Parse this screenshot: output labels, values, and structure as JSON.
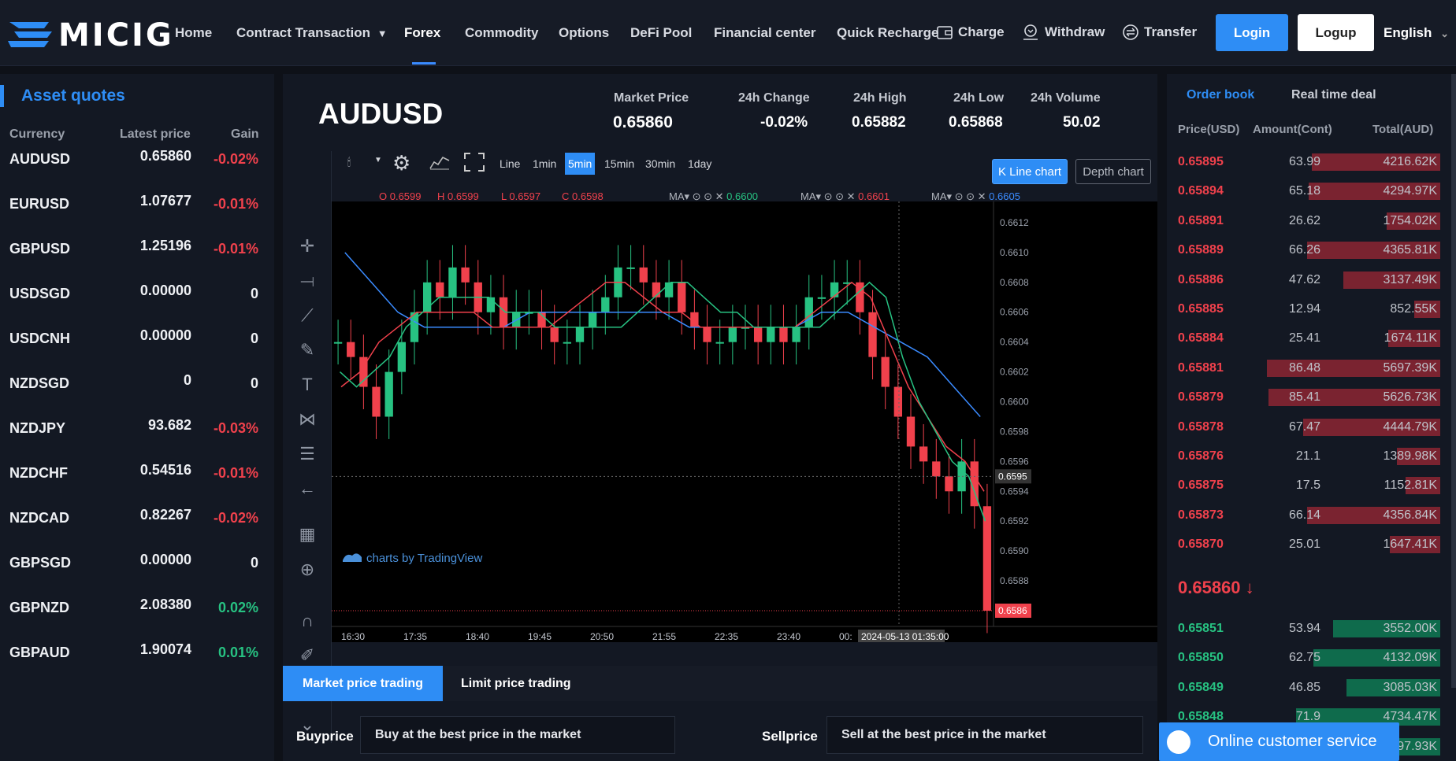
{
  "nav": {
    "logo_text": "MICIG",
    "items": [
      "Home",
      "Contract Transaction",
      "Forex",
      "Commodity",
      "Options",
      "DeFi Pool",
      "Financial center",
      "Quick Recharge"
    ],
    "actions": [
      "Charge",
      "Withdraw",
      "Transfer"
    ],
    "login_label": "Login",
    "logup_label": "Logup",
    "language": "English"
  },
  "quotes": {
    "title": "Asset quotes",
    "headers": [
      "Currency",
      "Latest price",
      "Gain"
    ],
    "rows": [
      {
        "sym": "AUDUSD",
        "price": "0.65860",
        "gain": "-0.02%",
        "dir": "neg"
      },
      {
        "sym": "EURUSD",
        "price": "1.07677",
        "gain": "-0.01%",
        "dir": "neg"
      },
      {
        "sym": "GBPUSD",
        "price": "1.25196",
        "gain": "-0.01%",
        "dir": "neg"
      },
      {
        "sym": "USDSGD",
        "price": "0.00000",
        "gain": "0",
        "dir": "zero"
      },
      {
        "sym": "USDCNH",
        "price": "0.00000",
        "gain": "0",
        "dir": "zero"
      },
      {
        "sym": "NZDSGD",
        "price": "0",
        "gain": "0",
        "dir": "zero"
      },
      {
        "sym": "NZDJPY",
        "price": "93.682",
        "gain": "-0.03%",
        "dir": "neg"
      },
      {
        "sym": "NZDCHF",
        "price": "0.54516",
        "gain": "-0.01%",
        "dir": "neg"
      },
      {
        "sym": "NZDCAD",
        "price": "0.82267",
        "gain": "-0.02%",
        "dir": "neg"
      },
      {
        "sym": "GBPSGD",
        "price": "0.00000",
        "gain": "0",
        "dir": "zero"
      },
      {
        "sym": "GBPNZD",
        "price": "2.08380",
        "gain": "0.02%",
        "dir": "pos"
      },
      {
        "sym": "GBPAUD",
        "price": "1.90074",
        "gain": "0.01%",
        "dir": "pos"
      }
    ]
  },
  "ticker": {
    "pair": "AUDUSD",
    "market_price_label": "Market Price",
    "market_price": "0.65860",
    "change_label": "24h Change",
    "change": "-0.02%",
    "high_label": "24h High",
    "high": "0.65882",
    "low_label": "24h Low",
    "low": "0.65868",
    "volume_label": "24h Volume",
    "volume": "50.02"
  },
  "chart_toolbar": {
    "intervals": [
      "Line",
      "1min",
      "5min",
      "15min",
      "30min",
      "1day"
    ],
    "selected": "5min",
    "kline_label": "K Line chart",
    "depth_label": "Depth chart",
    "ohlc": {
      "o": "O 0.6599",
      "h": "H 0.6599",
      "l": "L 0.6597",
      "c": "C 0.6598"
    },
    "ma": [
      {
        "label": "MA",
        "value": "0.6600",
        "color": "#27c282"
      },
      {
        "label": "MA",
        "value": "0.6601",
        "color": "#f0414c"
      },
      {
        "label": "MA",
        "value": "0.6605",
        "color": "#3a8bff"
      }
    ],
    "watermark": "charts by TradingView"
  },
  "chart_data": {
    "type": "candlestick",
    "pair": "AUDUSD",
    "interval": "5min",
    "x_ticks": [
      "16:30",
      "17:35",
      "18:40",
      "19:45",
      "20:50",
      "21:55",
      "22:35",
      "23:40",
      "00:"
    ],
    "crosshair_time": "2024-05-13 01:35:00",
    "y_ticks": [
      "0.6612",
      "0.6610",
      "0.6608",
      "0.6606",
      "0.6604",
      "0.6602",
      "0.6600",
      "0.6598",
      "0.6596",
      "0.6594",
      "0.6592",
      "0.6590",
      "0.6588"
    ],
    "ylim": [
      0.6586,
      0.6613
    ],
    "crosshair_price": "0.6595",
    "last_price": "0.6586",
    "close_series": [
      0.6604,
      0.6603,
      0.6601,
      0.6599,
      0.6602,
      0.6604,
      0.6606,
      0.6608,
      0.6607,
      0.6609,
      0.6608,
      0.6606,
      0.6607,
      0.6605,
      0.6606,
      0.6606,
      0.6605,
      0.6604,
      0.6604,
      0.6605,
      0.6606,
      0.6607,
      0.6609,
      0.6609,
      0.6608,
      0.6607,
      0.6608,
      0.6606,
      0.6605,
      0.6604,
      0.6604,
      0.6605,
      0.6605,
      0.6604,
      0.6605,
      0.6604,
      0.6605,
      0.6607,
      0.6607,
      0.6608,
      0.6608,
      0.6606,
      0.6603,
      0.6601,
      0.6599,
      0.6597,
      0.6596,
      0.6595,
      0.6594,
      0.6596,
      0.6593,
      0.6586
    ],
    "ma_green": [
      0.6602,
      0.6601,
      0.6602,
      0.6603,
      0.6605,
      0.6606,
      0.6607,
      0.6607,
      0.6607,
      0.6607,
      0.6606,
      0.6606,
      0.6606,
      0.6605,
      0.6605,
      0.6605,
      0.6605,
      0.6605,
      0.6606,
      0.6607,
      0.6608,
      0.6608,
      0.6607,
      0.6606,
      0.6606,
      0.6605,
      0.6605,
      0.6605,
      0.6605,
      0.6605,
      0.6606,
      0.6607,
      0.6608,
      0.6607,
      0.6603,
      0.66,
      0.6598,
      0.6596,
      0.6595,
      0.6592
    ],
    "ma_red": [
      0.6601,
      0.6602,
      0.6604,
      0.6605,
      0.6606,
      0.6606,
      0.6606,
      0.6606,
      0.6605,
      0.6605,
      0.6605,
      0.6605,
      0.6606,
      0.6607,
      0.6608,
      0.6608,
      0.6607,
      0.6606,
      0.6606,
      0.6605,
      0.6605,
      0.6605,
      0.6605,
      0.6605,
      0.6605,
      0.6606,
      0.6607,
      0.6608,
      0.6607,
      0.6604,
      0.6601,
      0.6599,
      0.6597,
      0.6596,
      0.6594
    ],
    "ma_blue": [
      0.661,
      0.6608,
      0.6606,
      0.6605,
      0.6605,
      0.6605,
      0.6605,
      0.6606,
      0.6606,
      0.6606,
      0.6606,
      0.6606,
      0.6606,
      0.6605,
      0.6605,
      0.6605,
      0.6605,
      0.6605,
      0.6606,
      0.6606,
      0.6605,
      0.6604,
      0.6603,
      0.6601,
      0.6599
    ]
  },
  "trade": {
    "tab_market": "Market price trading",
    "tab_limit": "Limit price trading",
    "buy_label": "Buyprice",
    "buy_value": "Buy at the best price in the market",
    "sell_label": "Sellprice",
    "sell_value": "Sell at the best price in the market"
  },
  "orderbook": {
    "tab_book": "Order book",
    "tab_deal": "Real time deal",
    "headers": [
      "Price(USD)",
      "Amount(Cont)",
      "Total(AUD)"
    ],
    "asks": [
      {
        "p": "0.65895",
        "a": "63.99",
        "t": "4216.62K",
        "depth": 0.74
      },
      {
        "p": "0.65894",
        "a": "65.18",
        "t": "4294.97K",
        "depth": 0.76
      },
      {
        "p": "0.65891",
        "a": "26.62",
        "t": "1754.02K",
        "depth": 0.31
      },
      {
        "p": "0.65889",
        "a": "66.26",
        "t": "4365.81K",
        "depth": 0.77
      },
      {
        "p": "0.65886",
        "a": "47.62",
        "t": "3137.49K",
        "depth": 0.56
      },
      {
        "p": "0.65885",
        "a": "12.94",
        "t": "852.55K",
        "depth": 0.15
      },
      {
        "p": "0.65884",
        "a": "25.41",
        "t": "1674.11K",
        "depth": 0.3
      },
      {
        "p": "0.65881",
        "a": "86.48",
        "t": "5697.39K",
        "depth": 1.0
      },
      {
        "p": "0.65879",
        "a": "85.41",
        "t": "5626.73K",
        "depth": 0.99
      },
      {
        "p": "0.65878",
        "a": "67.47",
        "t": "4444.79K",
        "depth": 0.79
      },
      {
        "p": "0.65876",
        "a": "21.1",
        "t": "1389.98K",
        "depth": 0.25
      },
      {
        "p": "0.65875",
        "a": "17.5",
        "t": "1152.81K",
        "depth": 0.2
      },
      {
        "p": "0.65873",
        "a": "66.14",
        "t": "4356.84K",
        "depth": 0.77
      },
      {
        "p": "0.65870",
        "a": "25.01",
        "t": "1647.41K",
        "depth": 0.29
      }
    ],
    "current_price": "0.65860 ↓",
    "bids": [
      {
        "p": "0.65851",
        "a": "53.94",
        "t": "3552.00K",
        "depth": 0.62
      },
      {
        "p": "0.65850",
        "a": "62.75",
        "t": "4132.09K",
        "depth": 0.73
      },
      {
        "p": "0.65849",
        "a": "46.85",
        "t": "3085.03K",
        "depth": 0.54
      },
      {
        "p": "0.65848",
        "a": "71.9",
        "t": "4734.47K",
        "depth": 0.83
      },
      {
        "p": "",
        "a": "",
        "t": "97.93K",
        "depth": 0.5
      }
    ]
  },
  "support": {
    "label": "Online customer service"
  },
  "colors": {
    "accent": "#2e8df5",
    "up": "#27c282",
    "down": "#f0414c",
    "ask_bar": "#7a2330",
    "bid_bar": "#0f6b4c"
  }
}
